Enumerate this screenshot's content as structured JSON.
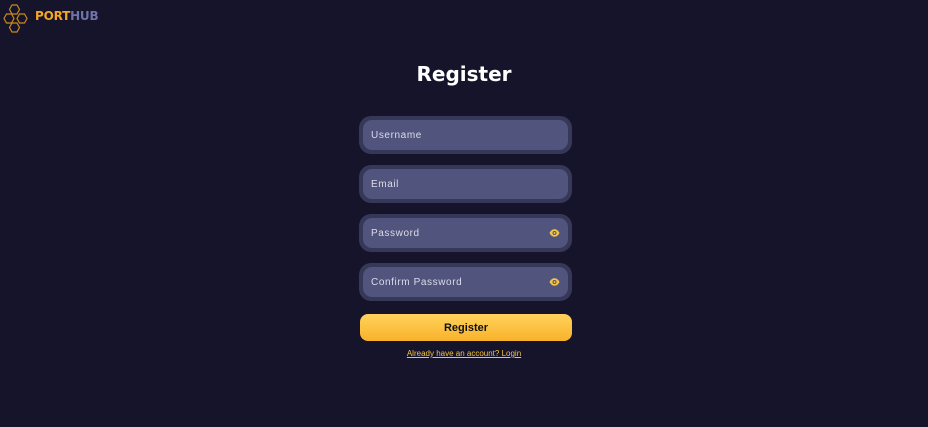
{
  "brand": {
    "part1": "PORT",
    "part2": "HUB",
    "colors": {
      "port": "#f5a623",
      "hub": "#6f74a8",
      "hex_outline": "#c98a1b"
    }
  },
  "form": {
    "title": "Register",
    "fields": [
      {
        "name": "username",
        "placeholder": "Username",
        "value": "",
        "type": "text",
        "has_visibility_toggle": false
      },
      {
        "name": "email",
        "placeholder": "Email",
        "value": "",
        "type": "email",
        "has_visibility_toggle": false
      },
      {
        "name": "password",
        "placeholder": "Password",
        "value": "",
        "type": "password",
        "has_visibility_toggle": true,
        "toggle_icon": "eye-icon"
      },
      {
        "name": "confirm_password",
        "placeholder": "Confirm Password",
        "value": "",
        "type": "password",
        "has_visibility_toggle": true,
        "toggle_icon": "eye-icon"
      }
    ],
    "submit_label": "Register",
    "login_link": "Already have an account? Login"
  },
  "theme": {
    "background": "#15142a",
    "field_outer": "#363857",
    "field_inner": "#51547c",
    "accent": "#f9b22b",
    "link": "#f5c542"
  }
}
